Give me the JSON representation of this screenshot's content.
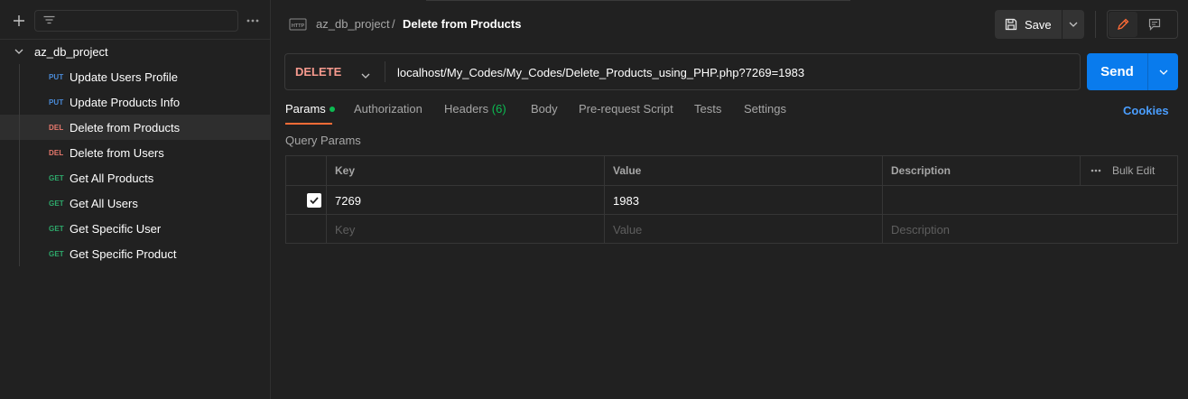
{
  "sidebar": {
    "new_icon": "plus-icon",
    "filter_icon": "filter-icon",
    "more_icon": "more-horizontal-icon",
    "filter_placeholder": "",
    "collection": {
      "name": "az_db_project",
      "expanded": true
    },
    "requests": [
      {
        "method": "PUT",
        "name": "Update Users Profile",
        "active": false
      },
      {
        "method": "PUT",
        "name": "Update Products Info",
        "active": false
      },
      {
        "method": "DEL",
        "name": "Delete from Products",
        "active": true
      },
      {
        "method": "DEL",
        "name": "Delete from Users",
        "active": false
      },
      {
        "method": "GET",
        "name": "Get All Products",
        "active": false
      },
      {
        "method": "GET",
        "name": "Get All Users",
        "active": false
      },
      {
        "method": "GET",
        "name": "Get Specific User",
        "active": false
      },
      {
        "method": "GET",
        "name": "Get Specific Product",
        "active": false
      }
    ]
  },
  "header": {
    "breadcrumb_collection": "az_db_project",
    "breadcrumb_separator": "/",
    "breadcrumb_request": "Delete from Products",
    "save_label": "Save"
  },
  "request": {
    "method": "DELETE",
    "url": "localhost/My_Codes/My_Codes/Delete_Products_using_PHP.php?7269=1983",
    "send_label": "Send"
  },
  "tabs": {
    "params": "Params",
    "authorization": "Authorization",
    "headers": "Headers",
    "headers_count": "(6)",
    "body": "Body",
    "prerequest": "Pre-request Script",
    "tests": "Tests",
    "settings": "Settings",
    "active": "params"
  },
  "cookies_label": "Cookies",
  "query_params": {
    "title": "Query Params",
    "columns": {
      "key": "Key",
      "value": "Value",
      "description": "Description",
      "bulk_edit": "Bulk Edit"
    },
    "rows": [
      {
        "checked": true,
        "key": "7269",
        "value": "1983",
        "description": ""
      }
    ],
    "placeholder": {
      "key": "Key",
      "value": "Value",
      "description": "Description"
    }
  },
  "colors": {
    "background": "#212121",
    "put": "#4a8bd8",
    "del": "#e8796d",
    "get": "#2ea96b",
    "send": "#097bed",
    "tab_underline": "#ff6c37",
    "cookies": "#4a9eff"
  }
}
